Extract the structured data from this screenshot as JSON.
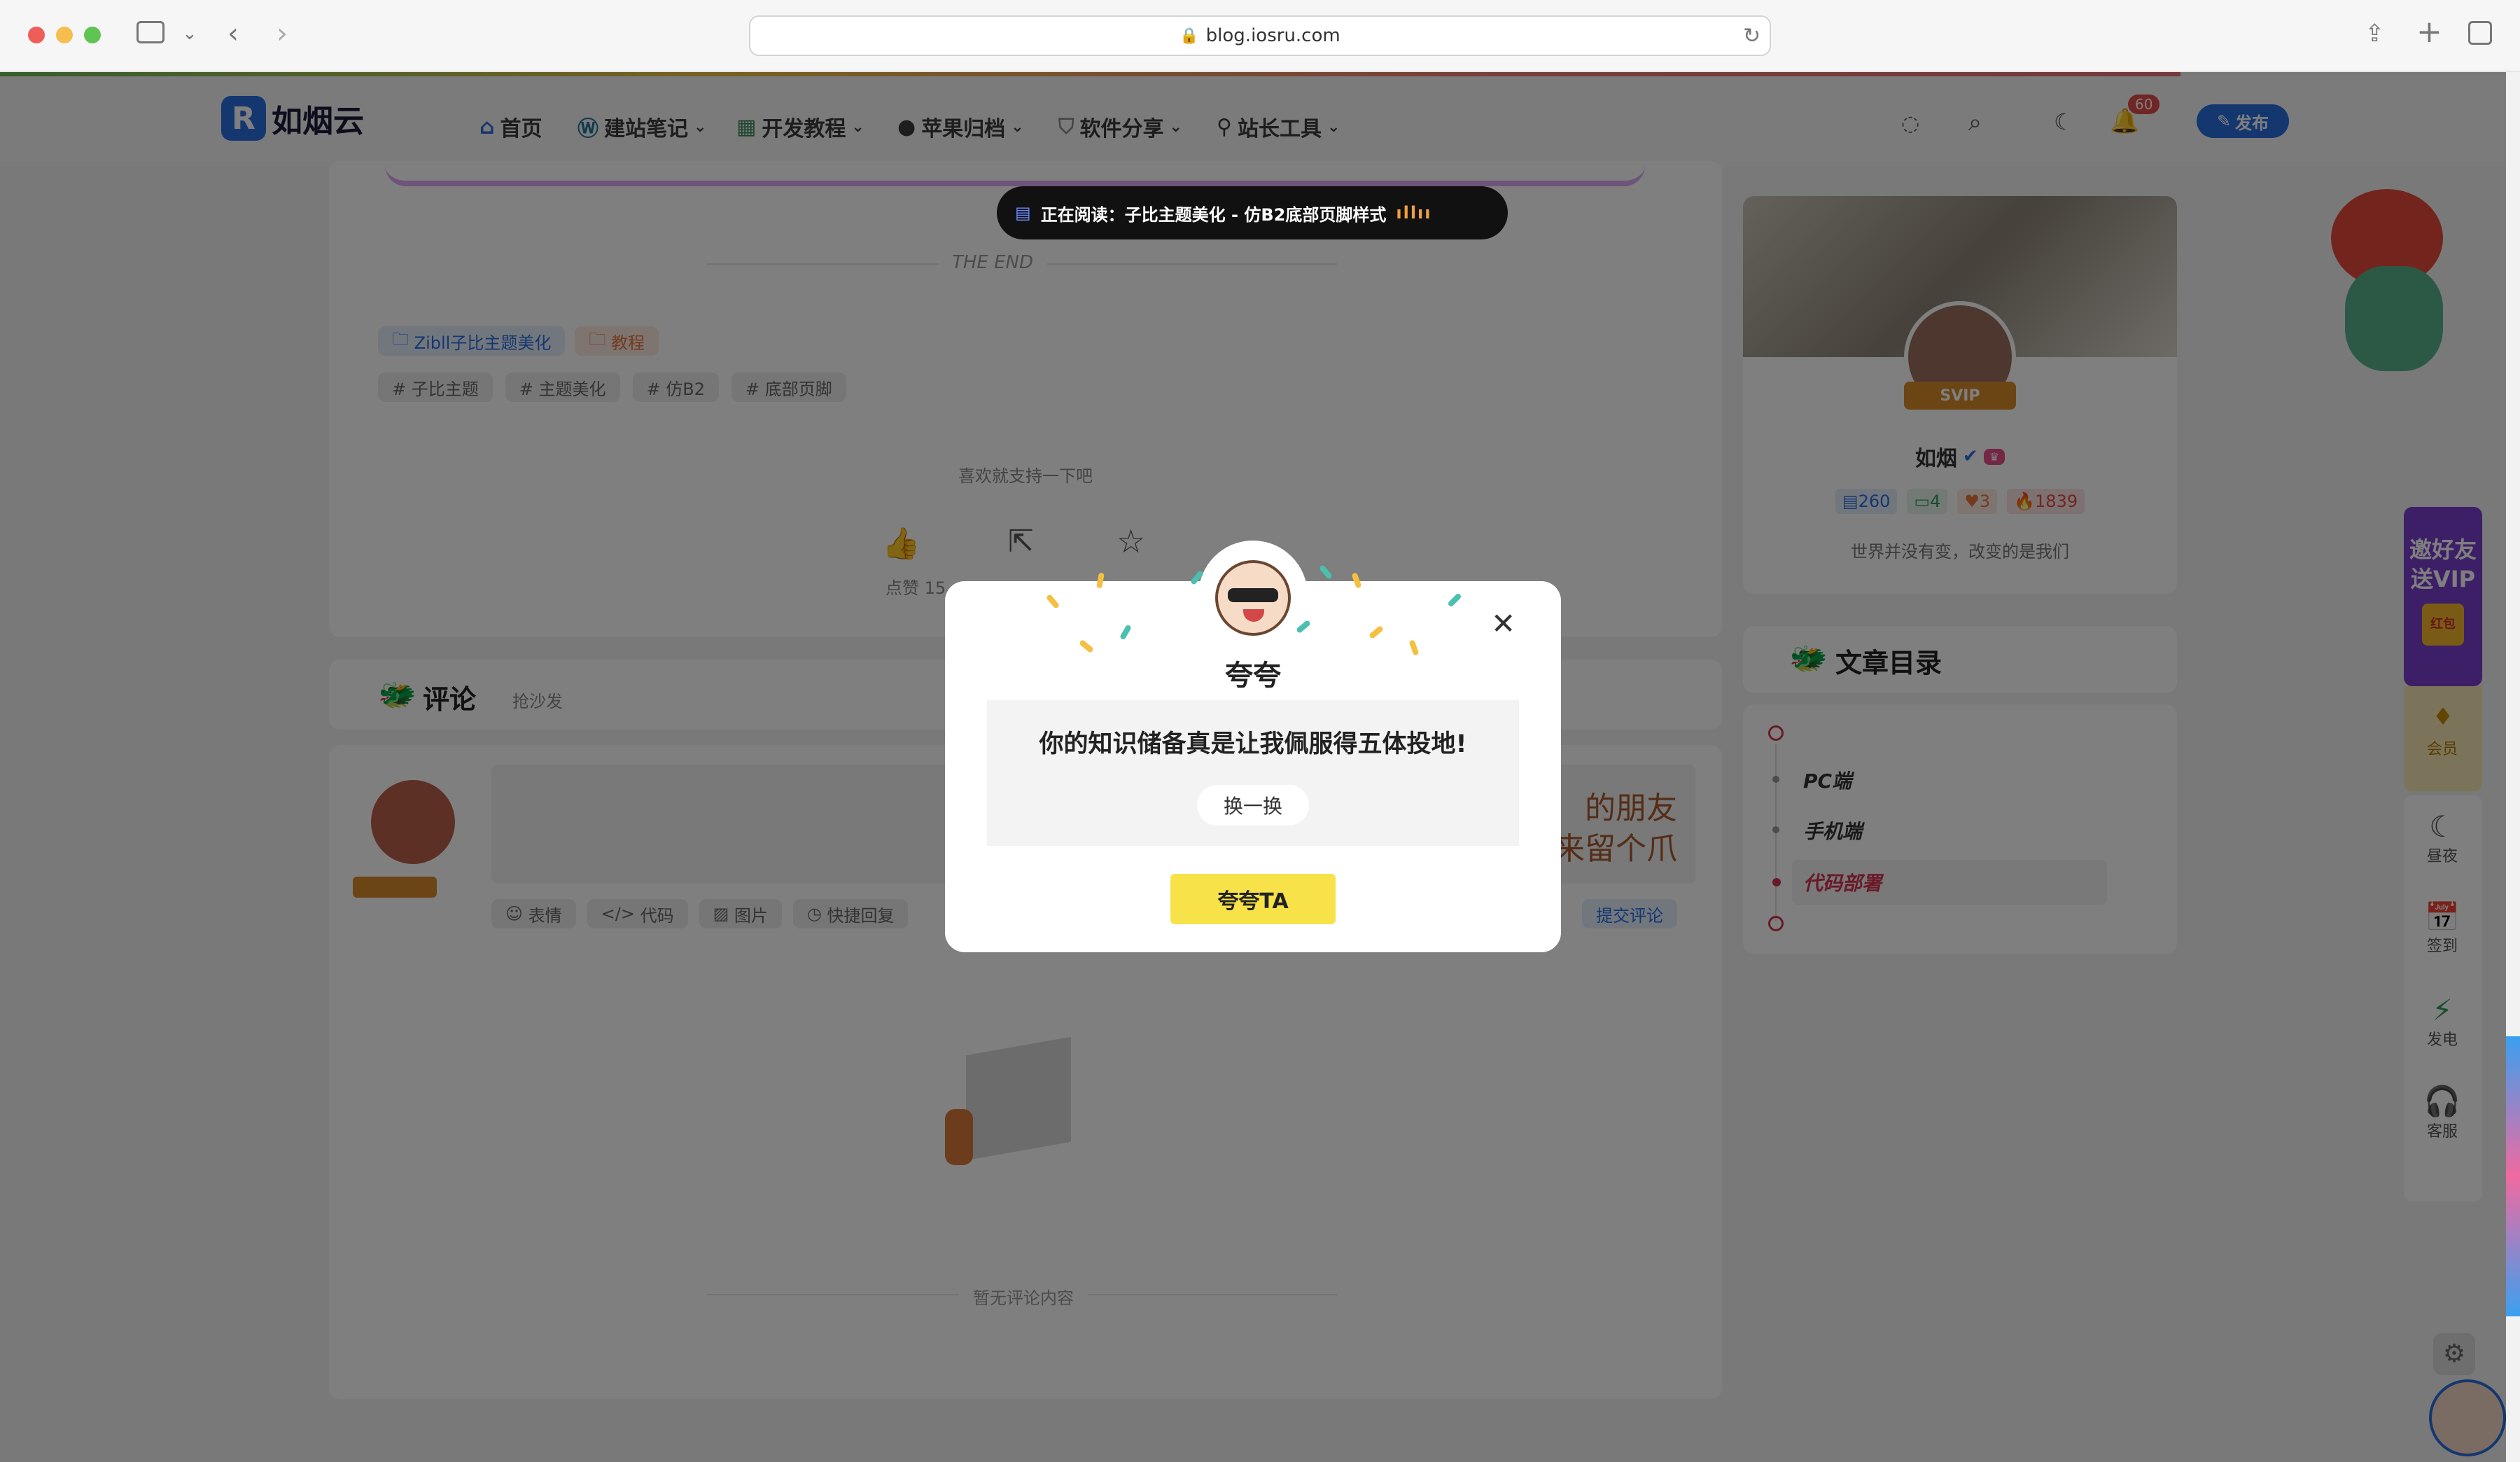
{
  "browser": {
    "url": "blog.iosru.com"
  },
  "header": {
    "logo": "如烟云",
    "nav": [
      {
        "label": "首页",
        "icon": "home-icon"
      },
      {
        "label": "建站笔记",
        "icon": "wordpress-icon"
      },
      {
        "label": "开发教程",
        "icon": "code-icon"
      },
      {
        "label": "苹果归档",
        "icon": "apple-icon"
      },
      {
        "label": "软件分享",
        "icon": "shield-icon"
      },
      {
        "label": "站长工具",
        "icon": "wrench-icon"
      }
    ],
    "notification_count": "60",
    "publish_label": "发布"
  },
  "reading_pill": "正在阅读：子比主题美化 - 仿B2底部页脚样式",
  "article": {
    "end_label": "THE END",
    "categories": [
      "Zibll子比主题美化",
      "教程"
    ],
    "tags": [
      "# 子比主题",
      "# 主题美化",
      "# 仿B2",
      "# 底部页脚"
    ],
    "support_text": "喜欢就支持一下吧",
    "like_label": "点赞 15"
  },
  "comments": {
    "title": "评论",
    "subtitle": "抢沙发",
    "toolbar": [
      "表情",
      "代码",
      "图片",
      "快捷回复"
    ],
    "submit_label": "提交评论",
    "placeholder_art": "的朋友\n来留个爪",
    "empty_text": "暂无评论内容"
  },
  "author": {
    "name": "如烟",
    "vip_badge": "SVIP",
    "stats": [
      "260",
      "4",
      "3",
      "1839"
    ],
    "motto": "世界并没有变，改变的是我们"
  },
  "toc": {
    "title": "文章目录",
    "items": [
      "PC端",
      "手机端",
      "代码部署"
    ]
  },
  "sidebar_float": {
    "invite": "邀好友送VIP",
    "invite_sub": "红包",
    "items": [
      "会员",
      "昼夜",
      "签到",
      "发电",
      "客服"
    ]
  },
  "modal": {
    "title": "夸夸",
    "message": "你的知识储备真是让我佩服得五体投地!",
    "refresh_label": "换一换",
    "action_label": "夸夸TA"
  },
  "colors": {
    "accent": "#2a6fe0",
    "modal_button": "#f7e24a",
    "toc_active": "#d2334f"
  }
}
